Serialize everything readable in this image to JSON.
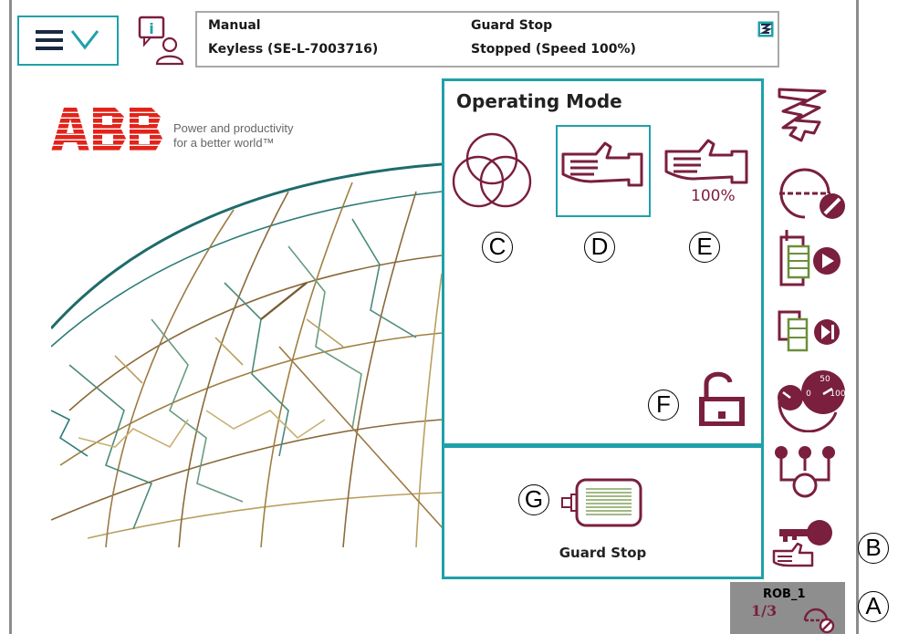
{
  "status": {
    "mode": "Manual",
    "key": "Keyless (SE-L-7003716)",
    "safety_state": "Guard Stop",
    "run_state": "Stopped (Speed 100%)"
  },
  "brand": {
    "logo": "ABB",
    "tagline_1": "Power and productivity",
    "tagline_2": "for a better world™"
  },
  "operating_mode": {
    "title": "Operating Mode",
    "options": [
      {
        "name": "auto-mode",
        "icon": "triple-circle-icon"
      },
      {
        "name": "manual-mode",
        "icon": "hand-icon",
        "selected": true
      },
      {
        "name": "manual-full-speed-mode",
        "icon": "hand-100-icon",
        "speed_label": "100%"
      }
    ],
    "lock_icon": "unlocked-padlock-icon"
  },
  "motors": {
    "label": "Guard Stop",
    "icon": "motor-icon"
  },
  "robot": {
    "name": "ROB_1",
    "task_fraction": "1/3"
  },
  "callouts": [
    "A",
    "B",
    "C",
    "D",
    "E",
    "F",
    "G"
  ],
  "colors": {
    "accent": "#1fa0aa",
    "icon": "#7a1f3d",
    "brand_red": "#e2231a",
    "frame": "#8c8c8c"
  }
}
